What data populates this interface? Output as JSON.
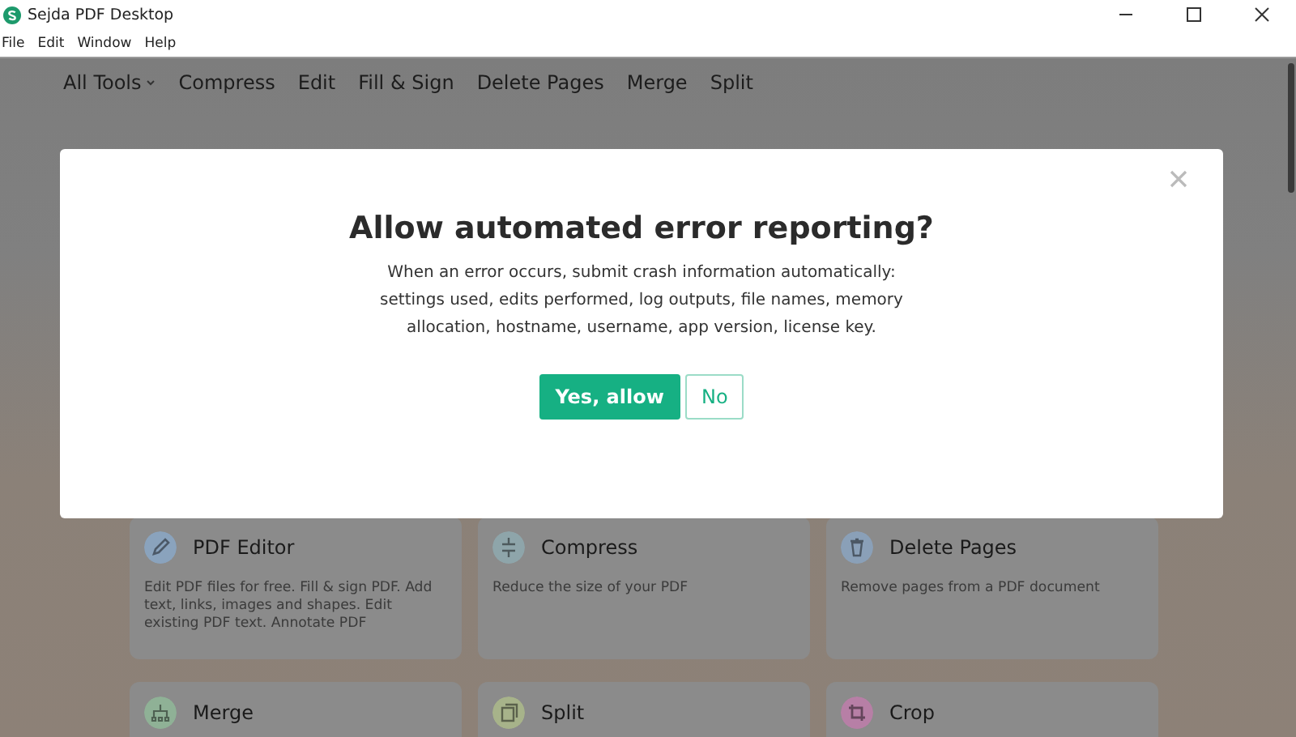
{
  "window": {
    "title": "Sejda PDF Desktop"
  },
  "menu": [
    "File",
    "Edit",
    "Window",
    "Help"
  ],
  "nav": [
    {
      "label": "All Tools",
      "kind": "dropdown"
    },
    {
      "label": "Compress",
      "kind": "link"
    },
    {
      "label": "Edit",
      "kind": "link"
    },
    {
      "label": "Fill & Sign",
      "kind": "link"
    },
    {
      "label": "Delete Pages",
      "kind": "link"
    },
    {
      "label": "Merge",
      "kind": "link"
    },
    {
      "label": "Split",
      "kind": "link"
    }
  ],
  "tools": [
    {
      "title": "PDF Editor",
      "description": "Edit PDF files for free. Fill & sign PDF. Add text, links, images and shapes. Edit existing PDF text. Annotate PDF",
      "kind": "pencil",
      "color": "#8aa3bd"
    },
    {
      "title": "Compress",
      "description": "Reduce the size of your PDF",
      "kind": "compress",
      "color": "#8ea5aa"
    },
    {
      "title": "Delete Pages",
      "description": "Remove pages from a PDF document",
      "kind": "trash",
      "color": "#8aa0b8"
    },
    {
      "title": "Merge",
      "kind": "merge",
      "color": "#8fb196"
    },
    {
      "title": "Split",
      "kind": "split",
      "color": "#a7b38a"
    },
    {
      "title": "Crop",
      "kind": "crop",
      "color": "#b77fa6"
    }
  ],
  "dialog": {
    "title": "Allow automated error reporting?",
    "body": "When an error occurs, submit crash information automatically: settings used, edits performed, log outputs, file names, memory allocation, hostname, username, app version, license key.",
    "buttons": [
      {
        "label": "Yes, allow",
        "kind": "primary"
      },
      {
        "label": "No",
        "kind": "secondary"
      }
    ]
  }
}
